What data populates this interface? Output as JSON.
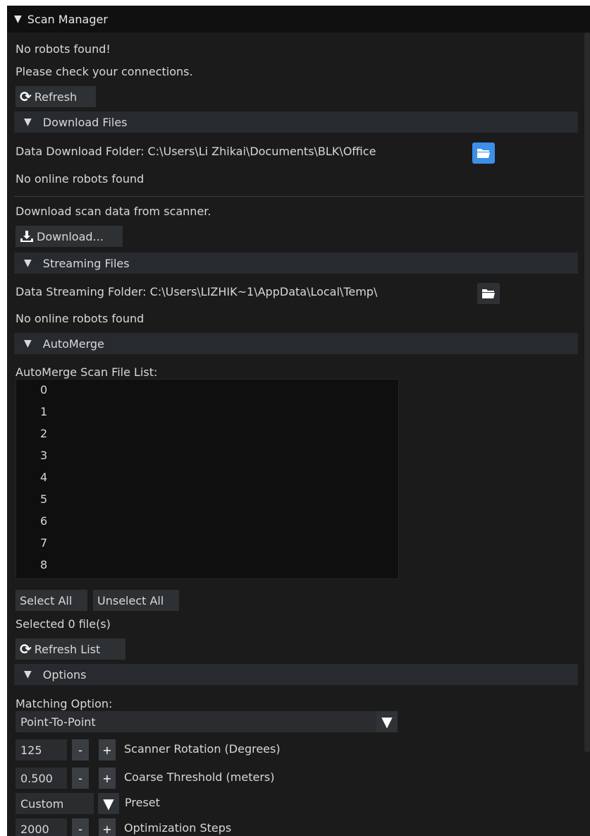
{
  "window": {
    "title": "Scan Manager"
  },
  "scan": {
    "line1": "No robots found!",
    "line2": "Please check your connections.",
    "refresh_label": "Refresh"
  },
  "download": {
    "header": "Download Files",
    "folder_text": "Data Download Folder: C:\\Users\\Li Zhikai\\Documents\\BLK\\Office",
    "status": "No online robots found",
    "desc": "Download scan data from scanner.",
    "button_label": "Download..."
  },
  "streaming": {
    "header": "Streaming Files",
    "folder_text": "Data Streaming Folder: C:\\Users\\LIZHIK~1\\AppData\\Local\\Temp\\",
    "status": "No online robots found"
  },
  "automerge": {
    "header": "AutoMerge",
    "list_label": "AutoMerge Scan File List:",
    "items": [
      "0",
      "1",
      "2",
      "3",
      "4",
      "5",
      "6",
      "7",
      "8"
    ],
    "select_all": "Select All",
    "unselect_all": "Unselect All",
    "selected_text": "Selected 0 file(s)",
    "refresh_list": "Refresh List"
  },
  "options": {
    "header": "Options",
    "matching_label": "Matching Option:",
    "matching_value": "Point-To-Point",
    "rotation": {
      "value": "125",
      "label": "Scanner Rotation (Degrees)"
    },
    "coarse": {
      "value": "0.500",
      "label": "Coarse Threshold (meters)"
    },
    "preset": {
      "value": "Custom",
      "label": "Preset"
    },
    "optimization": {
      "value": "2000",
      "label": "Optimization Steps"
    },
    "minus": "-",
    "plus": "+"
  },
  "colors": {
    "folder_icon_active": "#3d8fe8",
    "panel_bg": "#1b1b1b",
    "header_bg": "#272a2e"
  },
  "icons": {
    "collapse": "triangle-down-icon",
    "refresh": "refresh-icon",
    "download": "download-icon",
    "folder": "folder-icon"
  }
}
